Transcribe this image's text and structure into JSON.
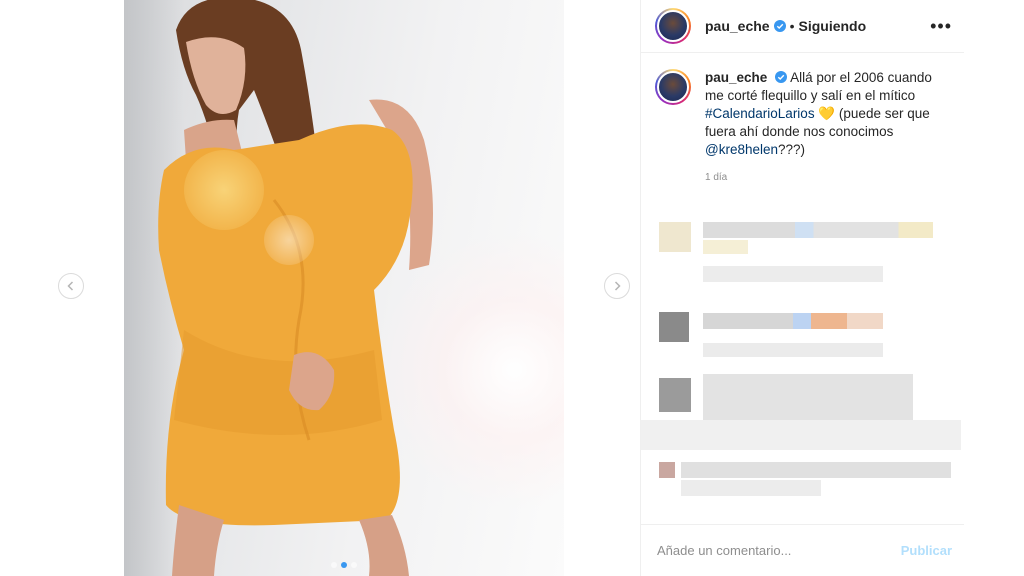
{
  "post": {
    "username": "pau_eche",
    "follow_separator": "•",
    "follow_status": "Siguiendo",
    "more_icon": "more-horizontal-icon",
    "caption": {
      "username": "pau_eche",
      "text_before": "Allá por el 2006 cuando me corté flequillo y salí en el mítico",
      "hashtag": "#CalendarioLarios",
      "emoji": "💛",
      "text_after": "(puede ser que fuera ahí donde nos conocimos",
      "mention": "@kre8helen",
      "text_end": "???)"
    },
    "time": "1 día",
    "carousel": {
      "total": 3,
      "active": 2
    }
  },
  "footer": {
    "comment_placeholder": "Añade un comentario...",
    "publish_label": "Publicar"
  },
  "colors": {
    "link": "#00376b",
    "verified": "#3897f0",
    "publish_disabled": "#b2dffc",
    "shirt": "#f0a93a"
  }
}
